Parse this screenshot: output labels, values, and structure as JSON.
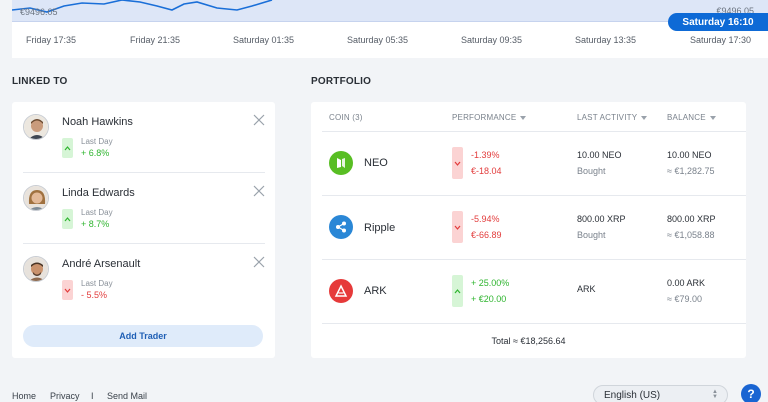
{
  "chart": {
    "low_label": "€9496.05",
    "high_label": "€9496.05",
    "current_time": "Saturday 16:10",
    "ticks": [
      "Friday 17:35",
      "Friday 21:35",
      "Saturday 01:35",
      "Saturday 05:35",
      "Saturday 09:35",
      "Saturday 13:35",
      "Saturday 17:30"
    ],
    "line_color": "#1a6fd8",
    "fill_color": "#dde6f7"
  },
  "linked": {
    "title": "LINKED TO",
    "add_button": "Add Trader",
    "traders": [
      {
        "name": "Noah Hawkins",
        "period": "Last Day",
        "change": "+ 6.8%",
        "trend": "up"
      },
      {
        "name": "Linda Edwards",
        "period": "Last Day",
        "change": "+ 8.7%",
        "trend": "up"
      },
      {
        "name": "André Arsenault",
        "period": "Last Day",
        "change": "- 5.5%",
        "trend": "down"
      }
    ]
  },
  "portfolio": {
    "title": "PORTFOLIO",
    "headers": {
      "coin": "COIN (3)",
      "performance": "PERFORMANCE",
      "activity": "LAST ACTIVITY",
      "balance": "BALANCE"
    },
    "rows": [
      {
        "coin": "NEO",
        "icon": "neo-icon",
        "color": "#58be23",
        "perf_pct": "-1.39%",
        "perf_val": "€-18.04",
        "trend": "down",
        "activity": "10.00 NEO",
        "activity_type": "Bought",
        "balance": "10.00 NEO",
        "balance_eur": "≈ €1,282.75"
      },
      {
        "coin": "Ripple",
        "icon": "ripple-icon",
        "color": "#2a87d6",
        "perf_pct": "-5.94%",
        "perf_val": "€-66.89",
        "trend": "down",
        "activity": "800.00 XRP",
        "activity_type": "Bought",
        "balance": "800.00 XRP",
        "balance_eur": "≈ €1,058.88"
      },
      {
        "coin": "ARK",
        "icon": "ark-icon",
        "color": "#e63a3a",
        "perf_pct": "+ 25.00%",
        "perf_val": "+ €20.00",
        "trend": "up",
        "activity": "ARK",
        "activity_type": "",
        "balance": "0.00 ARK",
        "balance_eur": "≈ €79.00"
      }
    ],
    "total": "Total ≈ €18,256.64"
  },
  "footer": {
    "links": [
      "Home",
      "Privacy",
      "Send Mail"
    ],
    "separator": "I",
    "language": "English (US)",
    "help": "?"
  }
}
